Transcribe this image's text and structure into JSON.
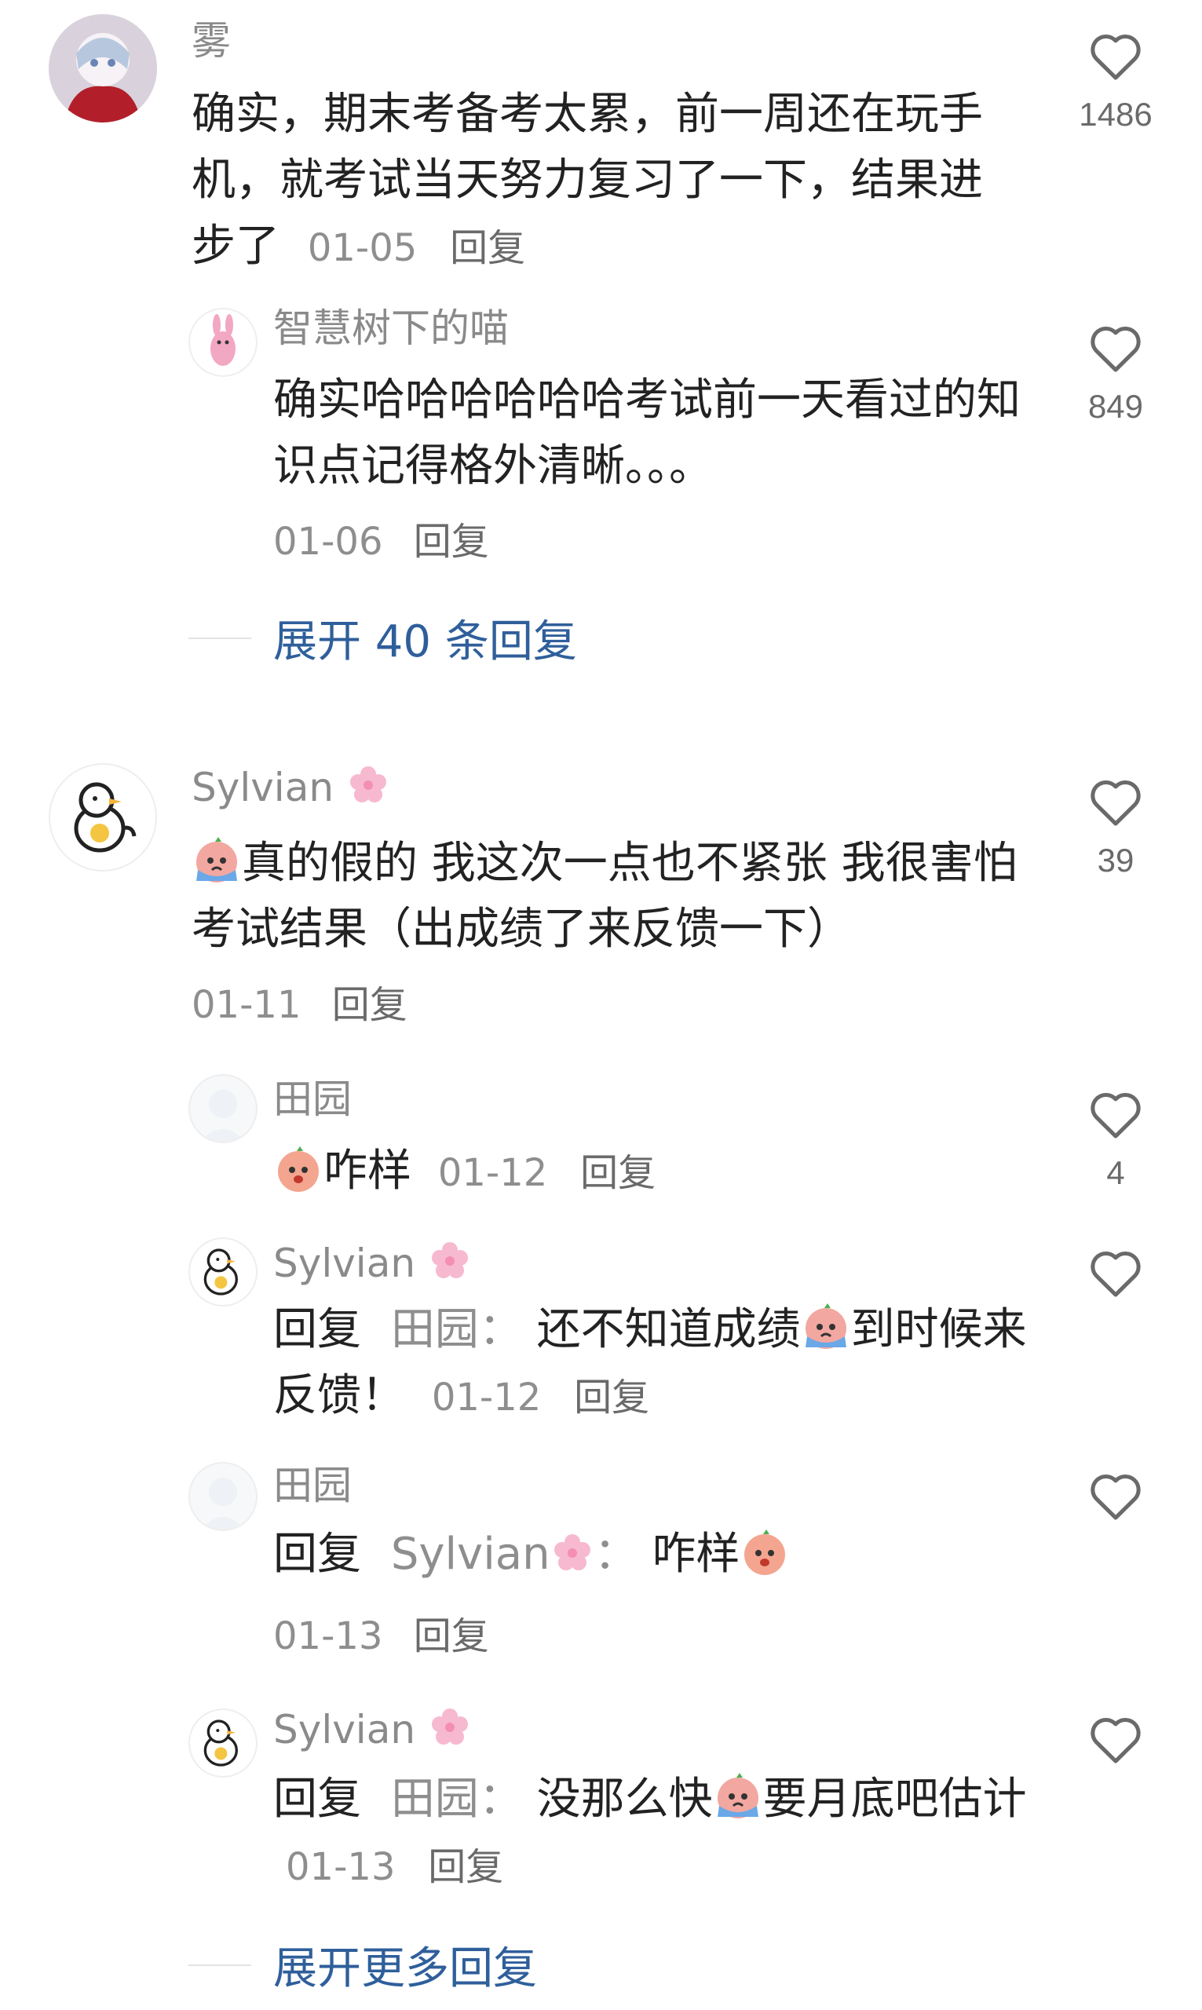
{
  "comments": [
    {
      "user": "雾",
      "text": "确实，期末考备考太累，前一周还在玩手机，就考试当天努力复习了一下，结果进步了",
      "date": "01-05",
      "reply_label": "回复",
      "likes": "1486"
    },
    {
      "user": "智慧树下的喵",
      "text": "确实哈哈哈哈哈哈考试前一天看过的知识点记得格外清晰。。。",
      "date": "01-06",
      "reply_label": "回复",
      "likes": "849"
    },
    {
      "expand_label": "展开 40 条回复"
    },
    {
      "user": "Sylvian",
      "text": "真的假的 我这次一点也不紧张 我很害怕考试结果（出成绩了来反馈一下）",
      "date": "01-11",
      "reply_label": "回复",
      "likes": "39"
    },
    {
      "user": "田园",
      "text": "咋样",
      "date": "01-12",
      "reply_label": "回复",
      "likes": "4"
    },
    {
      "user": "Sylvian",
      "reply_prefix": "回复",
      "reply_to": "田园",
      "colon": "：",
      "text_a": "还不知道成绩",
      "text_b": "到时候来反馈！",
      "date": "01-12",
      "reply_label": "回复"
    },
    {
      "user": "田园",
      "reply_prefix": "回复",
      "reply_to": "Sylvian",
      "colon": "：",
      "text": "咋样",
      "date": "01-13",
      "reply_label": "回复"
    },
    {
      "user": "Sylvian",
      "reply_prefix": "回复",
      "reply_to": "田园",
      "colon": "：",
      "text_a": "没那么快",
      "text_b": "要月底吧估计",
      "date": "01-13",
      "reply_label": "回复"
    },
    {
      "expand_label": "展开更多回复"
    }
  ],
  "icons": {
    "like": "heart-outline-icon",
    "flower": "sakura-emoji-icon",
    "crying": "crying-emoji-icon",
    "peach": "peach-emoji-icon"
  },
  "colors": {
    "link": "#2f5f9b",
    "muted": "#8e8e8e",
    "text": "#222222",
    "heart": "#6a6a6a"
  }
}
